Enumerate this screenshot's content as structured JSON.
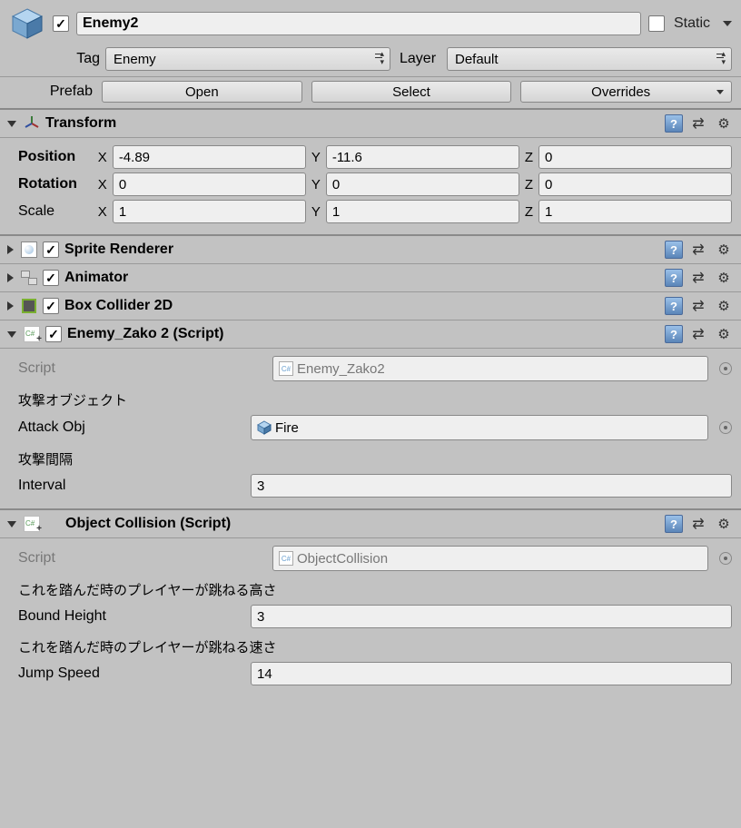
{
  "header": {
    "name": "Enemy2",
    "active": true,
    "static_label": "Static",
    "static_value": false
  },
  "tag_row": {
    "tag_label": "Tag",
    "tag_value": "Enemy",
    "layer_label": "Layer",
    "layer_value": "Default"
  },
  "prefab_row": {
    "label": "Prefab",
    "open_label": "Open",
    "select_label": "Select",
    "overrides_label": "Overrides"
  },
  "transform": {
    "title": "Transform",
    "position_label": "Position",
    "rotation_label": "Rotation",
    "scale_label": "Scale",
    "x": "X",
    "y": "Y",
    "z": "Z",
    "position": {
      "x": "-4.89",
      "y": "-11.6",
      "z": "0"
    },
    "rotation": {
      "x": "0",
      "y": "0",
      "z": "0"
    },
    "scale": {
      "x": "1",
      "y": "1",
      "z": "1"
    }
  },
  "sprite_renderer": {
    "title": "Sprite Renderer",
    "enabled": true
  },
  "animator": {
    "title": "Animator",
    "enabled": true
  },
  "box_collider": {
    "title": "Box Collider 2D",
    "enabled": true
  },
  "enemy_script": {
    "title": "Enemy_Zako 2 (Script)",
    "enabled": true,
    "script_label": "Script",
    "script_value": "Enemy_Zako2",
    "attack_header": "攻撃オブジェクト",
    "attack_label": "Attack Obj",
    "attack_value": "Fire",
    "interval_header": "攻撃間隔",
    "interval_label": "Interval",
    "interval_value": "3"
  },
  "object_collision": {
    "title": "Object Collision (Script)",
    "script_label": "Script",
    "script_value": "ObjectCollision",
    "bound_header": "これを踏んだ時のプレイヤーが跳ねる高さ",
    "bound_label": "Bound Height",
    "bound_value": "3",
    "jump_header": "これを踏んだ時のプレイヤーが跳ねる速さ",
    "jump_label": "Jump Speed",
    "jump_value": "14"
  }
}
